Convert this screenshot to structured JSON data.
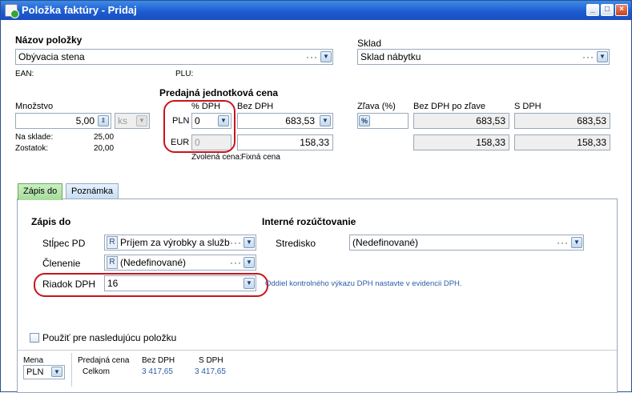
{
  "window": {
    "title": "Položka faktúry - Pridaj",
    "min": "_",
    "max": "□",
    "close": "×"
  },
  "item": {
    "label": "Názov položky",
    "value": "Obývacia stena",
    "ean_label": "EAN:",
    "plu_label": "PLU:"
  },
  "warehouse": {
    "label": "Sklad",
    "value": "Sklad nábytku"
  },
  "quantity": {
    "label": "Množstvo",
    "value": "5,00",
    "unit": "ks",
    "stock_label": "Na sklade:",
    "stock_value": "25,00",
    "rest_label": "Zostatok:",
    "rest_value": "20,00"
  },
  "price": {
    "section_label": "Predajná jednotková cena",
    "vat_label": "% DPH",
    "net_label": "Bez DPH",
    "pln_label": "PLN",
    "pln_vat": "0",
    "pln_net": "683,53",
    "eur_label": "EUR",
    "eur_vat": "0",
    "eur_net": "158,33",
    "selected_label": "Zvolená cena:",
    "selected_value": "Fixná cena"
  },
  "discount": {
    "label": "Zľava (%)",
    "icon": "%",
    "net_after_label": "Bez DPH po zľave",
    "gross_label": "S DPH",
    "pln_net_after": "683,53",
    "pln_gross": "683,53",
    "eur_net_after": "158,33",
    "eur_gross": "158,33"
  },
  "tabs": [
    "Zápis do",
    "Poznámka"
  ],
  "posting": {
    "title": "Zápis do",
    "column_label": "Stĺpec PD",
    "column_value": "Príjem za výrobky a služby",
    "division_label": "Členenie",
    "division_value": "(Nedefinované)",
    "vatrow_label": "Riadok DPH",
    "vatrow_value": "16",
    "r_tag": "R"
  },
  "internal": {
    "title": "Interné rozúčtovanie",
    "center_label": "Stredisko",
    "center_value": "(Nedefinované)",
    "note": "Oddiel kontrolného výkazu DPH nastavte v evidencii DPH."
  },
  "use_next": {
    "label": "Použiť pre nasledujúcu položku"
  },
  "footer": {
    "currency_label": "Mena",
    "currency_value": "PLN",
    "price_label": "Predajná cena",
    "total_label": "Celkom",
    "net_label": "Bez DPH",
    "gross_label": "S DPH",
    "net_value": "3 417,65",
    "gross_value": "3 417,65"
  },
  "colors": {
    "annotation": "#c8141c",
    "link": "#2c5ea8"
  },
  "icons": {
    "dropdown": "chevron-down-icon",
    "more": "ellipsis-icon"
  }
}
